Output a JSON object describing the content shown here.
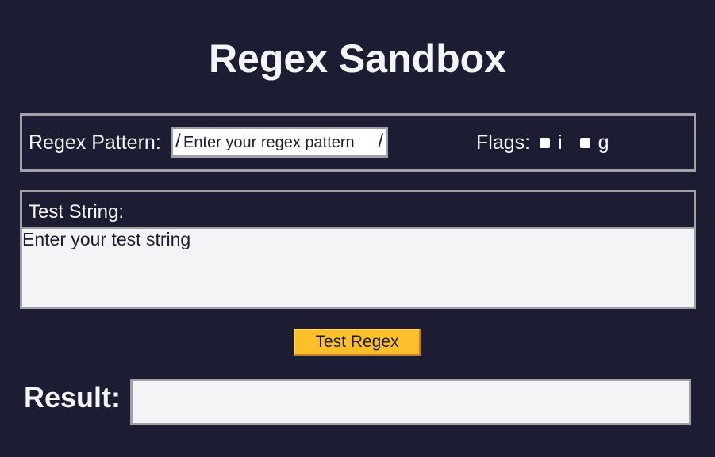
{
  "page": {
    "title": "Regex Sandbox"
  },
  "pattern": {
    "label": "Regex Pattern:",
    "delimiter_open": "/",
    "delimiter_close": "/",
    "placeholder": "Enter your regex pattern",
    "value": ""
  },
  "flags": {
    "label": "Flags:",
    "items": [
      {
        "letter": "i",
        "checked": false
      },
      {
        "letter": "g",
        "checked": false
      }
    ]
  },
  "test_string": {
    "label": "Test String:",
    "placeholder": "Enter your test string",
    "value": ""
  },
  "action": {
    "test_label": "Test Regex"
  },
  "result": {
    "label": "Result:",
    "value": ""
  },
  "colors": {
    "background": "#1c1d33",
    "border": "#a0a0a6",
    "field_background": "#f3f4f6",
    "button_accent": "#fbbf2c"
  },
  "icons": {
    "flag_checkbox": "checkbox-icon"
  }
}
